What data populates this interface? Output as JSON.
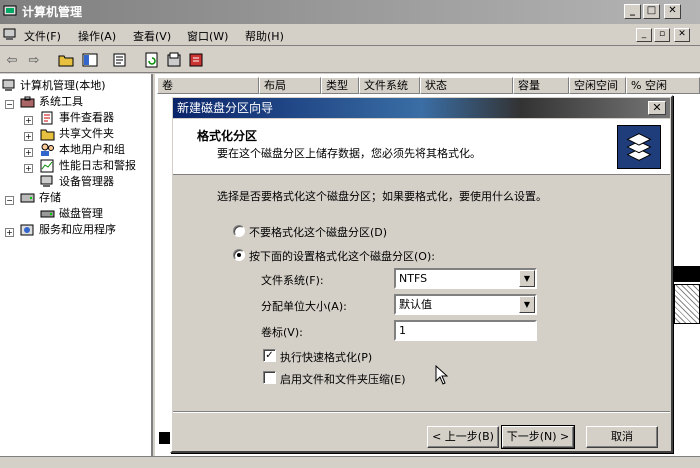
{
  "window": {
    "title": "计算机管理"
  },
  "menu": {
    "items": [
      "文件(F)",
      "操作(A)",
      "查看(V)",
      "窗口(W)",
      "帮助(H)"
    ]
  },
  "tree": {
    "root": "计算机管理(本地)",
    "system_tools": "系统工具",
    "event_viewer": "事件查看器",
    "shared_folders": "共享文件夹",
    "local_users": "本地用户和组",
    "perf_logs": "性能日志和警报",
    "device_manager": "设备管理器",
    "storage": "存储",
    "disk_management": "磁盘管理",
    "services_apps": "服务和应用程序"
  },
  "list": {
    "columns": [
      "卷",
      "布局",
      "类型",
      "文件系统",
      "状态",
      "容量",
      "空闲空间",
      "% 空闲"
    ]
  },
  "dialog": {
    "title": "新建磁盘分区向导",
    "close": "✕",
    "heading": "格式化分区",
    "subheading": "要在这个磁盘分区上储存数据，您必须先将其格式化。",
    "question": "选择是否要格式化这个磁盘分区；如果要格式化，要使用什么设置。",
    "option_no_format": "不要格式化这个磁盘分区(D)",
    "option_format": "按下面的设置格式化这个磁盘分区(O):",
    "fs_label": "文件系统(F):",
    "fs_value": "NTFS",
    "alloc_label": "分配单位大小(A):",
    "alloc_value": "默认值",
    "volume_label": "卷标(V):",
    "volume_value": "1",
    "quick_format": "执行快速格式化(P)",
    "compression": "启用文件和文件夹压缩(E)",
    "back": "< 上一步(B)",
    "next": "下一步(N) >",
    "cancel": "取消"
  },
  "colors": {
    "dialog_title_start": "#0a246a",
    "dialog_title_end": "#3a6ea5"
  }
}
